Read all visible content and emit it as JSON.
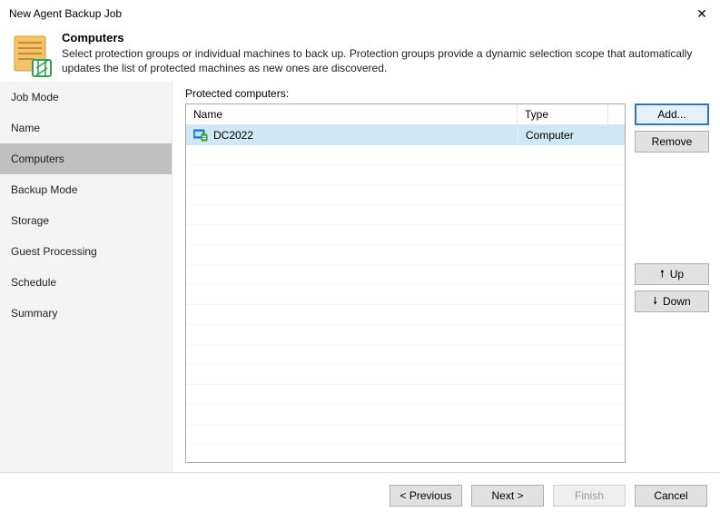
{
  "window": {
    "title": "New Agent Backup Job"
  },
  "header": {
    "heading": "Computers",
    "desc": "Select protection groups or individual machines to back up. Protection groups provide a dynamic selection scope that automatically updates the list of protected machines as new ones are discovered."
  },
  "sidebar": {
    "steps": [
      {
        "label": "Job Mode"
      },
      {
        "label": "Name"
      },
      {
        "label": "Computers"
      },
      {
        "label": "Backup Mode"
      },
      {
        "label": "Storage"
      },
      {
        "label": "Guest Processing"
      },
      {
        "label": "Schedule"
      },
      {
        "label": "Summary"
      }
    ],
    "active_index": 2
  },
  "main": {
    "section_label": "Protected computers:",
    "columns": {
      "name": "Name",
      "type": "Type"
    },
    "rows": [
      {
        "name": "DC2022",
        "type": "Computer",
        "selected": true
      }
    ]
  },
  "buttons": {
    "add": "Add...",
    "remove": "Remove",
    "up": "Up",
    "down": "Down"
  },
  "footer": {
    "previous": "< Previous",
    "next": "Next >",
    "finish": "Finish",
    "cancel": "Cancel"
  }
}
